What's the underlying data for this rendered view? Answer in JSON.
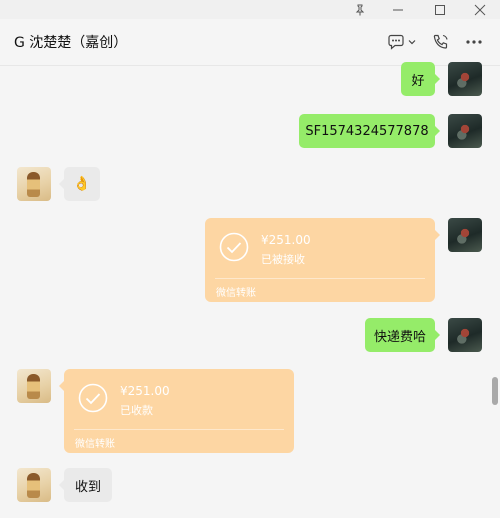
{
  "window": {
    "pin_icon": "pin-icon",
    "minimize_icon": "minimize-icon",
    "maximize_icon": "maximize-icon",
    "close_icon": "close-icon"
  },
  "header": {
    "title": "G 沈楚楚（嘉创）",
    "chat_icon": "chat-bubble-icon",
    "call_icon": "phone-icon",
    "more_icon": "more-icon"
  },
  "messages": [
    {
      "sender": "self",
      "type": "text",
      "text": "好"
    },
    {
      "sender": "self",
      "type": "text",
      "text": "SF1574324577878"
    },
    {
      "sender": "other",
      "type": "text",
      "text": "👌"
    },
    {
      "sender": "self",
      "type": "transfer",
      "amount": "¥251.00",
      "status": "已被接收",
      "footer": "微信转账"
    },
    {
      "sender": "self",
      "type": "text",
      "text": "快递费哈"
    },
    {
      "sender": "other",
      "type": "transfer",
      "amount": "¥251.00",
      "status": "已收款",
      "footer": "微信转账"
    },
    {
      "sender": "other",
      "type": "text",
      "text": "收到"
    }
  ],
  "colors": {
    "self_bubble": "#95ec69",
    "other_bubble": "#eaeaea",
    "transfer_card": "#fdd6a3",
    "background": "#f5f5f5"
  }
}
